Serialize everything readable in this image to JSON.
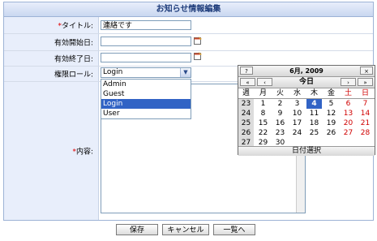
{
  "form": {
    "title": "お知らせ情報編集",
    "required_mark": "*",
    "fields": {
      "title_label": "タイトル:",
      "title_value": "連絡です",
      "start_label": "有効開始日:",
      "end_label": "有効終了日:",
      "role_label": "権限ロール:",
      "role_value": "Login",
      "content_label": "内容:"
    },
    "role_options": [
      "Admin",
      "Guest",
      "Login",
      "User"
    ],
    "buttons": {
      "save": "保存",
      "cancel": "キャンセル",
      "list": "一覧へ"
    }
  },
  "calendar": {
    "help": "?",
    "close": "×",
    "month_title": "6月, 2009",
    "prev_year": "«",
    "prev_month": "‹",
    "today": "今日",
    "next_month": "›",
    "next_year": "»",
    "week_header": "週",
    "days": [
      "月",
      "火",
      "水",
      "木",
      "金",
      "土",
      "日"
    ],
    "weeks": [
      {
        "wk": "23",
        "d": [
          "1",
          "2",
          "3",
          "4",
          "5",
          "6",
          "7"
        ]
      },
      {
        "wk": "24",
        "d": [
          "8",
          "9",
          "10",
          "11",
          "12",
          "13",
          "14"
        ]
      },
      {
        "wk": "25",
        "d": [
          "15",
          "16",
          "17",
          "18",
          "19",
          "20",
          "21"
        ]
      },
      {
        "wk": "26",
        "d": [
          "22",
          "23",
          "24",
          "25",
          "26",
          "27",
          "28"
        ]
      },
      {
        "wk": "27",
        "d": [
          "29",
          "30",
          "",
          "",
          "",
          "",
          ""
        ]
      }
    ],
    "selected_day": "4",
    "footer": "日付選択"
  }
}
